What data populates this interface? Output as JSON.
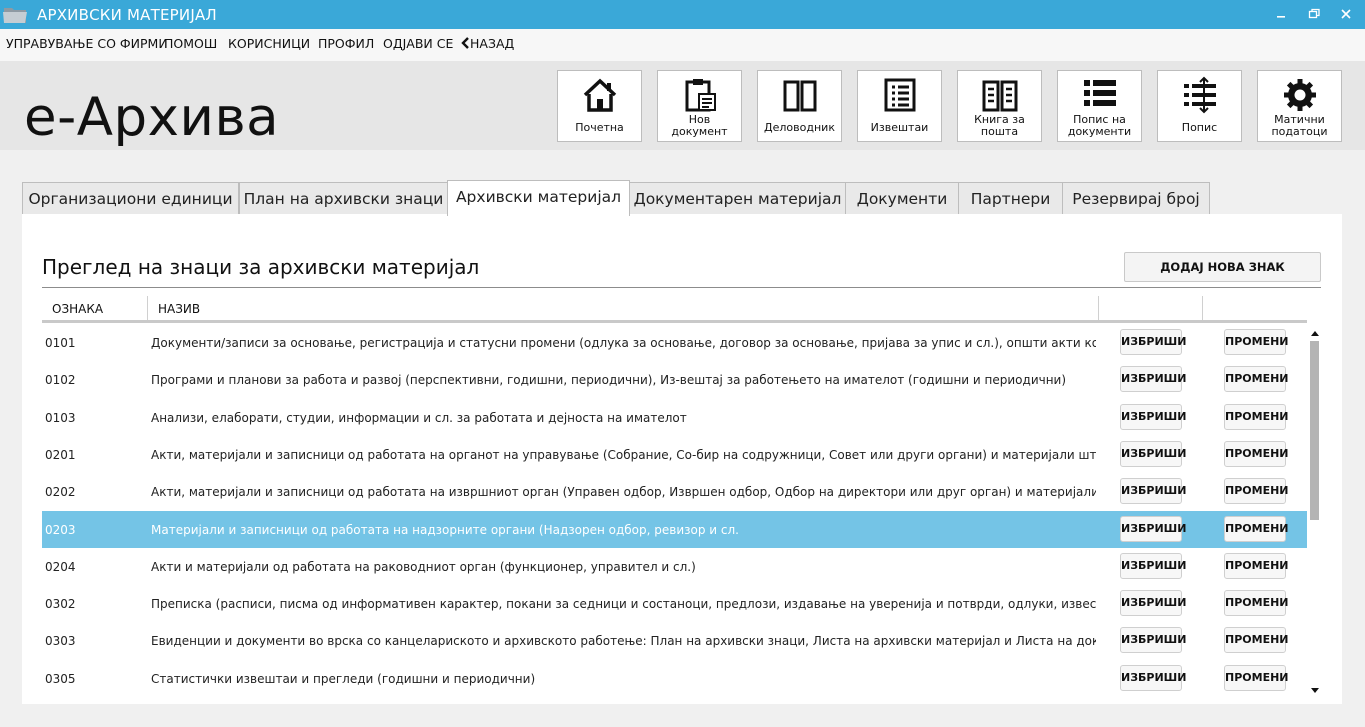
{
  "window": {
    "title": "АРХИВСКИ МАТЕРИЈАЛ"
  },
  "menu": {
    "items": [
      "УПРАВУВАЊЕ СО ФИРМИ",
      "ПОМОШ",
      "КОРИСНИЦИ",
      "ПРОФИЛ",
      "ОДЈАВИ СЕ"
    ],
    "back": "НАЗАД"
  },
  "brand": "е-Архива",
  "toolbar": [
    {
      "icon": "home-icon",
      "label": "Почетна"
    },
    {
      "icon": "new-document-icon",
      "label": "Нов документ"
    },
    {
      "icon": "book-icon",
      "label": "Деловодник"
    },
    {
      "icon": "report-list-icon",
      "label": "Извештаи"
    },
    {
      "icon": "mail-book-icon",
      "label": "Книга за пошта"
    },
    {
      "icon": "document-list-icon",
      "label": "Попис на документи"
    },
    {
      "icon": "inventory-icon",
      "label": "Попис"
    },
    {
      "icon": "gear-icon",
      "label": "Матични податоци"
    }
  ],
  "tabs": [
    {
      "label": "Организациони единици",
      "active": false
    },
    {
      "label": "План на архивски знаци",
      "active": false
    },
    {
      "label": "Архивски материјал",
      "active": true
    },
    {
      "label": "Документарен материјал",
      "active": false
    },
    {
      "label": "Документи",
      "active": false
    },
    {
      "label": "Партнери",
      "active": false
    },
    {
      "label": "Резервирај број",
      "active": false
    }
  ],
  "panel": {
    "title": "Преглед на знаци за архивски материјал",
    "add_button": "ДОДАЈ НОВА ЗНАК"
  },
  "table": {
    "columns": [
      "ОЗНАКА",
      "НАЗИВ"
    ],
    "delete_label": "ИЗБРИШИ",
    "edit_label": "ПРОМЕНИ",
    "selected_index": 5,
    "rows": [
      {
        "code": "0101",
        "name": "Документи/записи за основање, регистрација и статусни промени (одлука за основање, договор за основање, пријава за упис и сл.), општи акти кои произлегуваат од надлежноста"
      },
      {
        "code": "0102",
        "name": "Програми и планови за работа и развој (перспективни, годишни, периодични), Из-вештај за работењето на имателот (годишни и периодични)"
      },
      {
        "code": "0103",
        "name": "Анализи, елаборати, студии, информации и сл. за работата и дејноста на имателот"
      },
      {
        "code": "0201",
        "name": "Акти, материјали и записници од работата на органот на управување (Собрание, Со-бир на содружници, Совет или други органи) и материјали што произлегуваат од до-несените"
      },
      {
        "code": "0202",
        "name": "Акти, материјали и записници од работата на извршниот орган (Управен одбор, Извршен одбор, Одбор на директори или друг орган) и материјали што произлегуваат од"
      },
      {
        "code": "0203",
        "name": "Материјали и записници од работата на надзорните органи (Надзорен одбор, ревизор и сл."
      },
      {
        "code": "0204",
        "name": "Акти и материјали од работата на раководниот орган (функционер, управител и сл.)"
      },
      {
        "code": "0302",
        "name": "Преписка (расписи, писма од информативен карактер, покани за седници и состаноци, предлози, издавање на уверенија и потврди, одлуки, известувања и писма добиени"
      },
      {
        "code": "0303",
        "name": "Евиденции и документи во врска со канцелариското и архивското работење: План на архивски знаци, Листа на архивски материјал и Листа на документарен материјал со"
      },
      {
        "code": "0305",
        "name": "Статистички извештаи и прегледи (годишни и периодични)"
      }
    ]
  },
  "colors": {
    "titlebar": "#3aa8d8",
    "selected_row": "#74c4e6"
  }
}
